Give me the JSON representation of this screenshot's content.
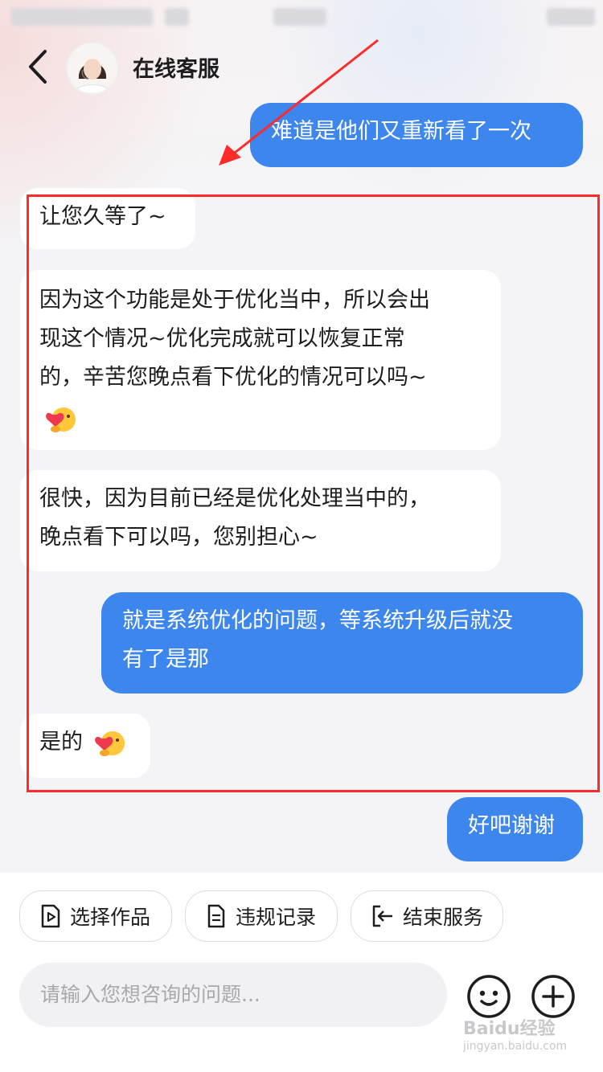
{
  "header": {
    "title": "在线客服",
    "back_icon": "chevron-left-icon"
  },
  "messages": [
    {
      "side": "right",
      "text": "难道是他们又重新看了一次"
    },
    {
      "side": "left",
      "text": "让您久等了~"
    },
    {
      "side": "left",
      "lines": [
        "因为这个功能是处于优化当中，所以会出",
        "现这个情况~优化完成就可以恢复正常",
        "的，辛苦您晚点看下优化的情况可以吗~"
      ],
      "emoji": "hug-heart-emoji"
    },
    {
      "side": "left",
      "lines": [
        "很快，因为目前已经是优化处理当中的，",
        "晚点看下可以吗，您别担心~"
      ]
    },
    {
      "side": "right",
      "lines": [
        "就是系统优化的问题，等系统升级后就没",
        "有了是那"
      ]
    },
    {
      "side": "left",
      "text": "是的",
      "emoji": "hug-heart-emoji"
    },
    {
      "side": "right",
      "text": "好吧谢谢"
    }
  ],
  "actions": [
    {
      "label": "选择作品",
      "icon": "video-file-icon"
    },
    {
      "label": "违规记录",
      "icon": "document-icon"
    },
    {
      "label": "结束服务",
      "icon": "exit-icon"
    }
  ],
  "input": {
    "placeholder": "请输入您想咨询的问题..."
  },
  "buttons": {
    "emoji_icon": "smiley-icon",
    "add_icon": "plus-icon"
  },
  "watermark": {
    "line1": "Baidu经验",
    "line2": "jingyan.baidu.com"
  },
  "colors": {
    "accent": "#3d86ee",
    "highlight_box": "#ff2a2a"
  }
}
